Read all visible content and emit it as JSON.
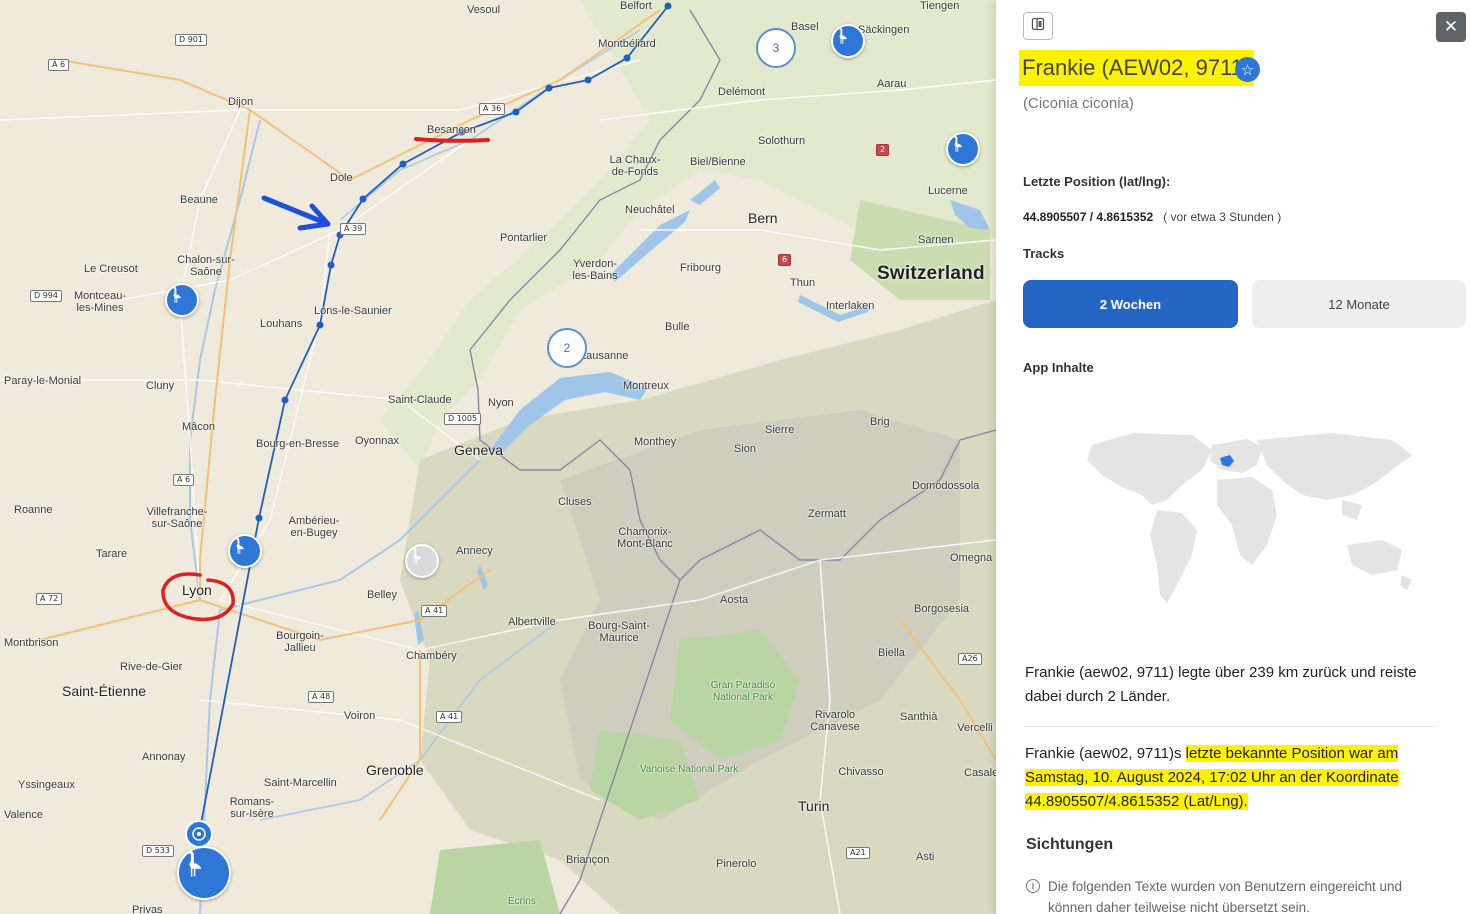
{
  "map": {
    "places": [
      {
        "name": "Vesoul",
        "cls": ""
      },
      {
        "name": "Belfort",
        "cls": ""
      },
      {
        "name": "Montbéliard",
        "cls": ""
      },
      {
        "name": "Dijon",
        "cls": ""
      },
      {
        "name": "Besançon",
        "cls": ""
      },
      {
        "name": "Dole",
        "cls": ""
      },
      {
        "name": "Delémont",
        "cls": ""
      },
      {
        "name": "Solothurn",
        "cls": ""
      },
      {
        "name": "Beaune",
        "cls": ""
      },
      {
        "name": "La Chaux-de-Fonds",
        "cls": ""
      },
      {
        "name": "Biel/Bienne",
        "cls": ""
      },
      {
        "name": "Neuchâtel",
        "cls": ""
      },
      {
        "name": "Bern",
        "cls": "city"
      },
      {
        "name": "Pontarlier",
        "cls": ""
      },
      {
        "name": "Le Creusot",
        "cls": ""
      },
      {
        "name": "Chalon-sur-Saône",
        "cls": ""
      },
      {
        "name": "Montceau-les-Mines",
        "cls": ""
      },
      {
        "name": "Yverdon-les-Bains",
        "cls": ""
      },
      {
        "name": "Fribourg",
        "cls": ""
      },
      {
        "name": "Thun",
        "cls": ""
      },
      {
        "name": "Switzerland",
        "cls": "country"
      },
      {
        "name": "Interlaken",
        "cls": ""
      },
      {
        "name": "Louhans",
        "cls": ""
      },
      {
        "name": "Lons-le-Saunier",
        "cls": ""
      },
      {
        "name": "Bulle",
        "cls": ""
      },
      {
        "name": "Lausanne",
        "cls": ""
      },
      {
        "name": "Paray-le-Monial",
        "cls": ""
      },
      {
        "name": "Montreux",
        "cls": ""
      },
      {
        "name": "Cluny",
        "cls": ""
      },
      {
        "name": "Nyon",
        "cls": ""
      },
      {
        "name": "Saint-Claude",
        "cls": ""
      },
      {
        "name": "Mâcon",
        "cls": ""
      },
      {
        "name": "Oyonnax",
        "cls": ""
      },
      {
        "name": "Sierre",
        "cls": ""
      },
      {
        "name": "Brig",
        "cls": ""
      },
      {
        "name": "Monthey",
        "cls": ""
      },
      {
        "name": "Bourg-en-Bresse",
        "cls": ""
      },
      {
        "name": "Geneva",
        "cls": "city"
      },
      {
        "name": "Sion",
        "cls": ""
      },
      {
        "name": "Domodossola",
        "cls": ""
      },
      {
        "name": "Cluses",
        "cls": ""
      },
      {
        "name": "Roanne",
        "cls": ""
      },
      {
        "name": "Villefranche-sur-Saône",
        "cls": ""
      },
      {
        "name": "Zermatt",
        "cls": ""
      },
      {
        "name": "Ambérieu-en-Bugey",
        "cls": ""
      },
      {
        "name": "Chamonix-Mont-Blanc",
        "cls": ""
      },
      {
        "name": "Tarare",
        "cls": ""
      },
      {
        "name": "Annecy",
        "cls": ""
      },
      {
        "name": "Omegna",
        "cls": ""
      },
      {
        "name": "Lyon",
        "cls": "city"
      },
      {
        "name": "Belley",
        "cls": ""
      },
      {
        "name": "Aosta",
        "cls": ""
      },
      {
        "name": "Borgosesia",
        "cls": ""
      },
      {
        "name": "Albertville",
        "cls": ""
      },
      {
        "name": "Bourg-Saint-Maurice",
        "cls": ""
      },
      {
        "name": "Montbrison",
        "cls": ""
      },
      {
        "name": "Bourgoin-Jallieu",
        "cls": ""
      },
      {
        "name": "Chambéry",
        "cls": ""
      },
      {
        "name": "Biella",
        "cls": ""
      },
      {
        "name": "Rive-de-Gier",
        "cls": ""
      },
      {
        "name": "Gran Paradiso National Park",
        "cls": "park"
      },
      {
        "name": "Saint-Étienne",
        "cls": "city"
      },
      {
        "name": "Santhià",
        "cls": ""
      },
      {
        "name": "Voiron",
        "cls": ""
      },
      {
        "name": "Rivarolo Canavese",
        "cls": ""
      },
      {
        "name": "Vercelli",
        "cls": ""
      },
      {
        "name": "Annonay",
        "cls": ""
      },
      {
        "name": "Grenoble",
        "cls": "city"
      },
      {
        "name": "Vanoise National Park",
        "cls": "park"
      },
      {
        "name": "Chivasso",
        "cls": ""
      },
      {
        "name": "Casale Monferrato",
        "cls": ""
      },
      {
        "name": "Yssingeaux",
        "cls": ""
      },
      {
        "name": "Saint-Marcellin",
        "cls": ""
      },
      {
        "name": "Romans-sur-Isère",
        "cls": ""
      },
      {
        "name": "Turin",
        "cls": "city"
      },
      {
        "name": "Valence",
        "cls": ""
      },
      {
        "name": "Pinerolo",
        "cls": ""
      },
      {
        "name": "Briançon",
        "cls": ""
      },
      {
        "name": "Asti",
        "cls": ""
      },
      {
        "name": "Privas",
        "cls": ""
      },
      {
        "name": "Écrins",
        "cls": "park"
      },
      {
        "name": "Säckingen",
        "cls": ""
      },
      {
        "name": "Tiengen",
        "cls": ""
      },
      {
        "name": "Basel",
        "cls": ""
      },
      {
        "name": "Aarau",
        "cls": ""
      },
      {
        "name": "Lucerne",
        "cls": ""
      },
      {
        "name": "Sarnen",
        "cls": ""
      }
    ],
    "roads": [
      {
        "name": "D 901",
        "cls": ""
      },
      {
        "name": "A 6",
        "cls": ""
      },
      {
        "name": "A 36",
        "cls": ""
      },
      {
        "name": "A 39",
        "cls": ""
      },
      {
        "name": "D 994",
        "cls": ""
      },
      {
        "name": "2",
        "cls": "red"
      },
      {
        "name": "6",
        "cls": "red"
      },
      {
        "name": "D 1005",
        "cls": ""
      },
      {
        "name": "A 6",
        "cls": ""
      },
      {
        "name": "A 72",
        "cls": ""
      },
      {
        "name": "A 41",
        "cls": ""
      },
      {
        "name": "A 48",
        "cls": ""
      },
      {
        "name": "A 41",
        "cls": ""
      },
      {
        "name": "A26",
        "cls": ""
      },
      {
        "name": "D 533",
        "cls": ""
      },
      {
        "name": "A21",
        "cls": ""
      }
    ],
    "clusters": [
      "3",
      "2"
    ],
    "markers": [
      {
        "name": "stork-marker",
        "color": "#2f77d6"
      },
      {
        "name": "stork-marker",
        "color": "#2f77d6"
      },
      {
        "name": "stork-marker",
        "color": "#2f77d6"
      },
      {
        "name": "stork-marker",
        "color": "#2f77d6"
      },
      {
        "name": "stork-marker",
        "color": "#d9d9d9"
      },
      {
        "name": "stork-marker-current",
        "color": "#2f77d6"
      }
    ],
    "track_color": "#1f5fbf",
    "annotation_color_red": "#e02020",
    "annotation_color_blue": "#1d4fd8"
  },
  "panel": {
    "title": "Frankie (AEW02, 9711)",
    "latin_name": "(Ciconia ciconia)",
    "last_position_label": "Letzte Position (lat/lng):",
    "last_position_value": "44.8905507 / 4.8615352",
    "last_position_ago": "( vor etwa 3 Stunden )",
    "tracks_label": "Tracks",
    "tab_active": "2 Wochen",
    "tab_inactive": "12 Monate",
    "app_content_label": "App Inhalte",
    "summary": "Frankie (aew02, 9711) legte über 239 km zurück und reiste dabei durch 2 Länder.",
    "last_known_prefix": "Frankie (aew02, 9711)s ",
    "last_known_highlight": "letzte bekannte Position war am Samstag, 10. August 2024, 17:02 Uhr an der Koordinate 44.8905507/4.8615352 (Lat/Lng).",
    "sightings_label": "Sichtungen",
    "sightings_info": "Die folgenden Texte wurden von Benutzern eingereicht und können daher teilweise nicht übersetzt sein.",
    "close_icon": "close-icon",
    "toggle_icon": "sidebar-toggle-icon",
    "highlight_color": "#fff200",
    "accent_color": "#2565c4"
  }
}
